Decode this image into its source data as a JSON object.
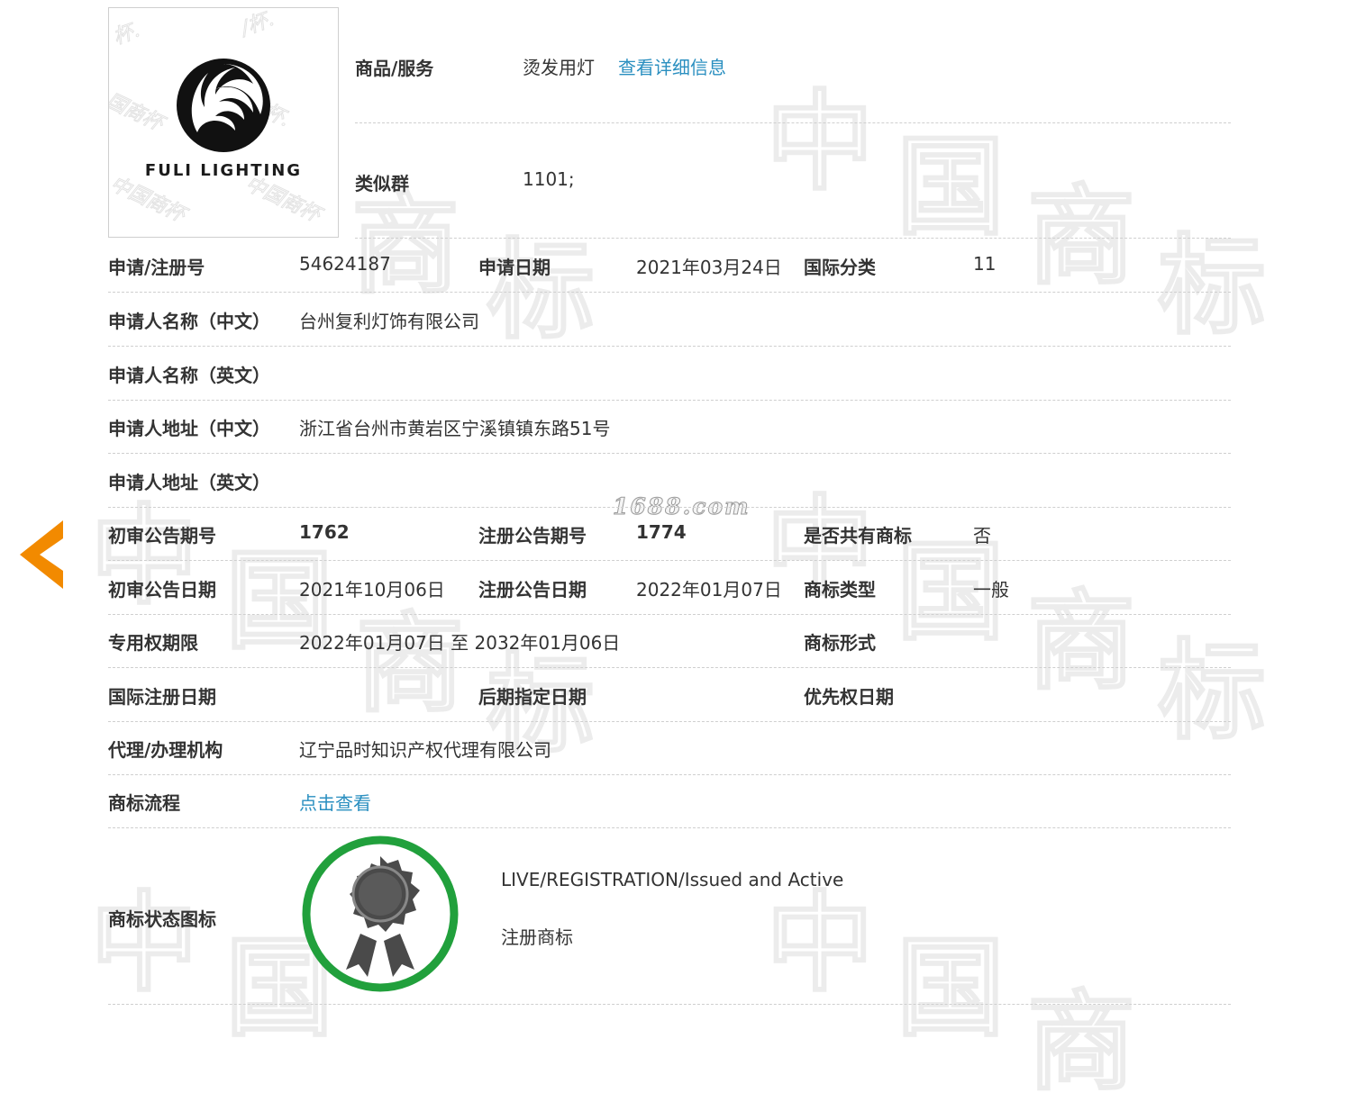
{
  "watermark_site": "1688.com",
  "logo": {
    "text": "FULI LIGHTING"
  },
  "goods": {
    "label": "商品/服务",
    "value": "烫发用灯",
    "link": "查看详细信息"
  },
  "similar_group": {
    "label": "类似群",
    "value": "1101;"
  },
  "application_no": {
    "label": "申请/注册号",
    "value": "54624187"
  },
  "application_date": {
    "label": "申请日期",
    "value": "2021年03月24日"
  },
  "intl_class": {
    "label": "国际分类",
    "value": "11"
  },
  "applicant_cn": {
    "label": "申请人名称（中文）",
    "value": "台州复利灯饰有限公司"
  },
  "applicant_en": {
    "label": "申请人名称（英文）",
    "value": ""
  },
  "address_cn": {
    "label": "申请人地址（中文）",
    "value": "浙江省台州市黄岩区宁溪镇镇东路51号"
  },
  "address_en": {
    "label": "申请人地址（英文）",
    "value": ""
  },
  "prelim_issue": {
    "label": "初审公告期号",
    "value": "1762"
  },
  "reg_issue": {
    "label": "注册公告期号",
    "value": "1774"
  },
  "shared_mark": {
    "label": "是否共有商标",
    "value": "否"
  },
  "prelim_date": {
    "label": "初审公告日期",
    "value": "2021年10月06日"
  },
  "reg_date": {
    "label": "注册公告日期",
    "value": "2022年01月07日"
  },
  "mark_type": {
    "label": "商标类型",
    "value": "一般"
  },
  "exclusive_period": {
    "label": "专用权期限",
    "value": "2022年01月07日 至 2032年01月06日"
  },
  "mark_form": {
    "label": "商标形式",
    "value": ""
  },
  "intl_reg_date": {
    "label": "国际注册日期",
    "value": ""
  },
  "later_designation": {
    "label": "后期指定日期",
    "value": ""
  },
  "priority_date": {
    "label": "优先权日期",
    "value": ""
  },
  "agency": {
    "label": "代理/办理机构",
    "value": "辽宁品时知识产权代理有限公司"
  },
  "process": {
    "label": "商标流程",
    "link": "点击查看"
  },
  "status": {
    "label": "商标状态图标",
    "line1": "LIVE/REGISTRATION/Issued and Active",
    "line2": "注册商标",
    "ring_color": "#21a03c",
    "medal_color": "#4a4a4a"
  },
  "nav": {
    "prev_icon": "chevron-left-icon",
    "color": "#f28a00"
  }
}
